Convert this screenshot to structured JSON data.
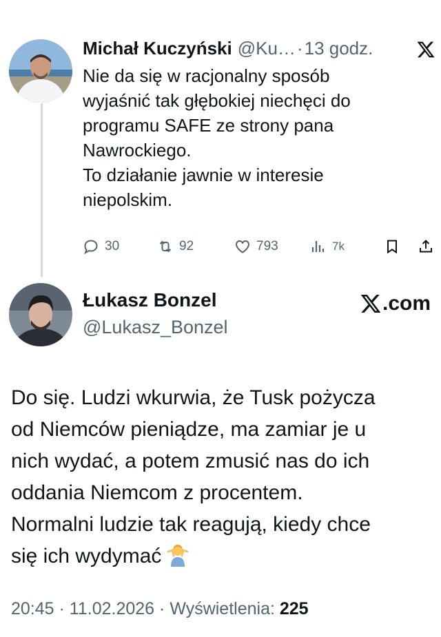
{
  "quoted_tweet": {
    "author_name": "Michał Kuczyński",
    "handle": "@Ku…",
    "separator": "·",
    "time_ago": "13 godz.",
    "text_lines": [
      "Nie da się w racjonalny sposób",
      "wyjaśnić tak głębokiej niechęci do",
      "programu SAFE ze strony pana",
      "Nawrockiego.",
      "To działanie jawnie w interesie",
      "niepolskim."
    ],
    "actions": {
      "replies": "30",
      "retweets": "92",
      "likes": "793",
      "views": "7k"
    }
  },
  "main_tweet": {
    "author_name": "Łukasz Bonzel",
    "handle": "@Lukasz_Bonzel",
    "brand": ".com",
    "text_lines": [
      "Do się. Ludzi wkurwia, że Tusk pożycza",
      "od Niemców pieniądze, ma zamiar je u",
      "nich wydać, a potem zmusić nas do ich",
      "oddania Niemcom z procentem.",
      "Normalni ludzie tak reagują, kiedy chce",
      "się ich wydymać"
    ],
    "emoji": "person-shrugging-emoji",
    "footer": {
      "time": "20:45",
      "sep": "·",
      "date": "11.02.2026",
      "views_label": "Wyświetlenia:",
      "views_count": "225"
    }
  },
  "colors": {
    "text": "#0f1419",
    "secondary": "#536471",
    "thread_line": "#cfd9de"
  }
}
